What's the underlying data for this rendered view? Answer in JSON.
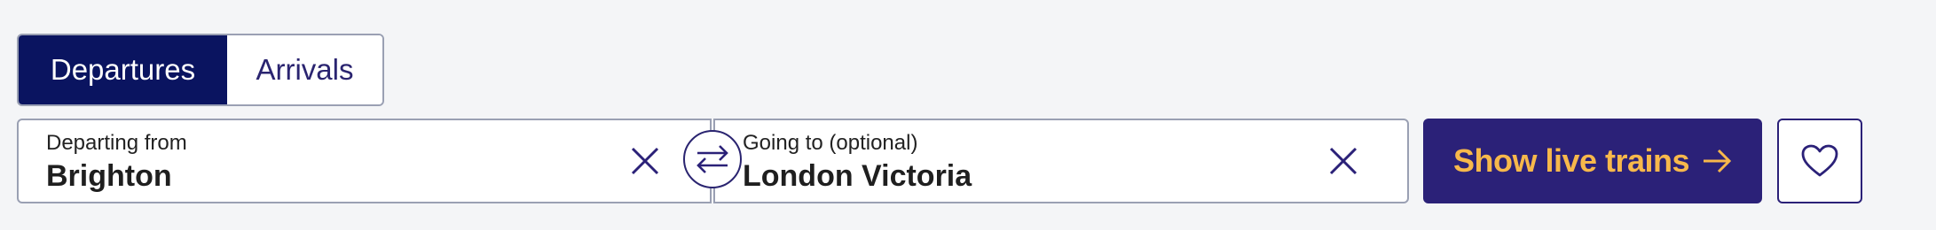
{
  "tabs": {
    "departures": "Departures",
    "arrivals": "Arrivals",
    "active": "departures"
  },
  "from": {
    "label": "Departing from",
    "value": "Brighton"
  },
  "to": {
    "label": "Going to (optional)",
    "value": "London Victoria"
  },
  "actions": {
    "show_label": "Show live trains"
  },
  "colors": {
    "navy": "#0a1460",
    "purple": "#2b2178",
    "accent": "#f7b84b",
    "border": "#9aa0b3",
    "background": "#f4f5f7"
  },
  "icons": {
    "clear": "close-icon",
    "swap": "swap-icon",
    "arrow": "arrow-right-icon",
    "favourite": "heart-icon"
  }
}
